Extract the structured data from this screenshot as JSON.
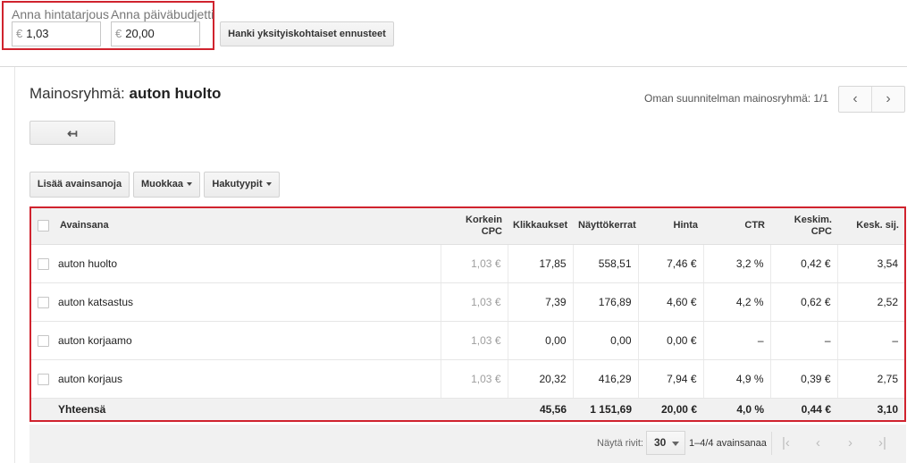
{
  "bid": {
    "label": "Anna hintatarjous",
    "currency": "€",
    "value": "1,03"
  },
  "budget": {
    "label": "Anna päiväbudjetti",
    "currency": "€",
    "value": "20,00"
  },
  "forecast_button": "Hanki yksityiskohtaiset ennusteet",
  "adgroup": {
    "prefix": "Mainosryhmä:",
    "name": "auton huolto"
  },
  "plan_pager": {
    "label": "Oman suunnitelman mainosryhmä: 1/1",
    "prev": "‹",
    "next": "›"
  },
  "back_icon": "↤",
  "toolbar": {
    "add_keywords": "Lisää avainsanoja",
    "edit": "Muokkaa",
    "match_types": "Hakutyypit"
  },
  "table": {
    "headers": {
      "keyword": "Avainsana",
      "max_cpc_1": "Korkein",
      "max_cpc_2": "CPC",
      "clicks": "Klikkaukset",
      "impressions": "Näyttökerrat",
      "cost": "Hinta",
      "ctr": "CTR",
      "avg_cpc_1": "Keskim.",
      "avg_cpc_2": "CPC",
      "avg_pos": "Kesk. sij."
    },
    "rows": [
      {
        "keyword": "auton huolto",
        "max_cpc": "1,03 €",
        "clicks": "17,85",
        "impressions": "558,51",
        "cost": "7,46 €",
        "ctr": "3,2 %",
        "avg_cpc": "0,42 €",
        "avg_pos": "3,54"
      },
      {
        "keyword": "auton katsastus",
        "max_cpc": "1,03 €",
        "clicks": "7,39",
        "impressions": "176,89",
        "cost": "4,60 €",
        "ctr": "4,2 %",
        "avg_cpc": "0,62 €",
        "avg_pos": "2,52"
      },
      {
        "keyword": "auton korjaamo",
        "max_cpc": "1,03 €",
        "clicks": "0,00",
        "impressions": "0,00",
        "cost": "0,00 €",
        "ctr": "–",
        "avg_cpc": "–",
        "avg_pos": "–"
      },
      {
        "keyword": "auton korjaus",
        "max_cpc": "1,03 €",
        "clicks": "20,32",
        "impressions": "416,29",
        "cost": "7,94 €",
        "ctr": "4,9 %",
        "avg_cpc": "0,39 €",
        "avg_pos": "2,75"
      }
    ],
    "total": {
      "label": "Yhteensä",
      "clicks": "45,56",
      "impressions": "1 151,69",
      "cost": "20,00 €",
      "ctr": "4,0 %",
      "avg_cpc": "0,44 €",
      "avg_pos": "3,10"
    }
  },
  "footer": {
    "rows_label": "Näytä rivit:",
    "rows_value": "30",
    "range": "1–4/4 avainsanaa",
    "first": "|‹",
    "prev": "‹",
    "next": "›",
    "last": "›|"
  },
  "colors": {
    "highlight": "#d0232e",
    "header_bg": "#f1f1f1",
    "muted_text": "#9e9e9e"
  }
}
